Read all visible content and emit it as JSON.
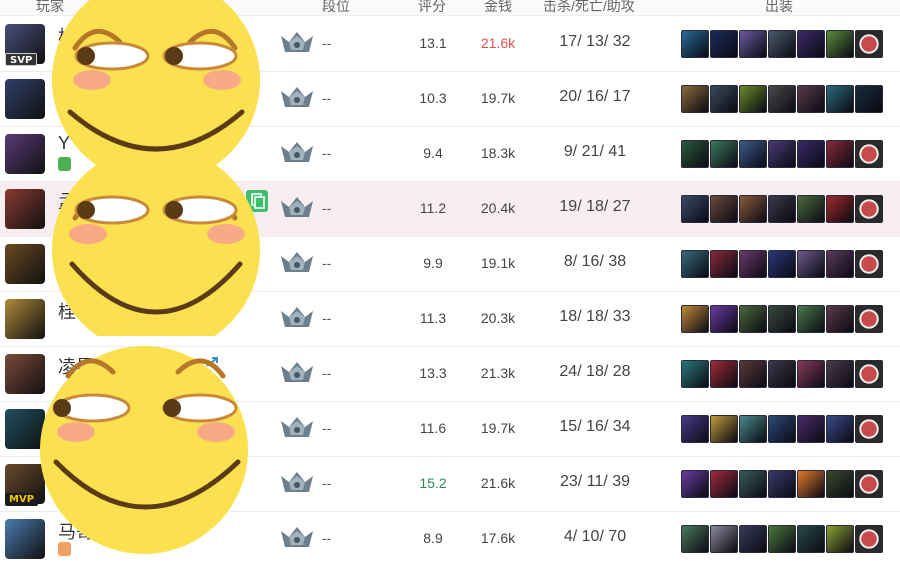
{
  "header": {
    "col_player": "玩家",
    "col_rank": "段位",
    "col_score": "评分",
    "col_gold": "金钱",
    "col_kda": "击杀/死亡/助攻",
    "col_items": "出装"
  },
  "colors": {
    "highlight_row": "#f8eef1",
    "gold_red": "#d9534f",
    "score_green": "#2e8b57",
    "kda_grey": "#888888"
  },
  "players": [
    {
      "name": "横",
      "badge": "SVP",
      "rank": "--",
      "score": "13.1",
      "gold": "21.6k",
      "k": "17",
      "d": "13",
      "a": "32",
      "avatar": "#4a4f7a"
    },
    {
      "name": "",
      "badge": "",
      "rank": "--",
      "score": "10.3",
      "gold": "19.7k",
      "k": "20",
      "d": "16",
      "a": "17",
      "avatar": "#2f3f6b"
    },
    {
      "name": "Y",
      "badge": "",
      "rank": "--",
      "score": "9.4",
      "gold": "18.3k",
      "k": "9",
      "d": "21",
      "a": "41",
      "avatar": "#5a3a7a"
    },
    {
      "name": "孟",
      "badge": "",
      "rank": "--",
      "score": "11.2",
      "gold": "20.4k",
      "k": "19",
      "d": "18",
      "a": "27",
      "avatar": "#8a3a30"
    },
    {
      "name": "",
      "badge": "",
      "rank": "--",
      "score": "9.9",
      "gold": "19.1k",
      "k": "8",
      "d": "16",
      "a": "38",
      "avatar": "#6b4a20"
    },
    {
      "name": "桂",
      "badge": "",
      "rank": "--",
      "score": "11.3",
      "gold": "20.3k",
      "k": "18",
      "d": "18",
      "a": "33",
      "avatar": "#b08a3a"
    },
    {
      "name": "凌晨",
      "badge": "",
      "rank": "--",
      "score": "13.3",
      "gold": "21.3k",
      "k": "24",
      "d": "18",
      "a": "28",
      "avatar": "#7a4a3a"
    },
    {
      "name": "",
      "badge": "",
      "rank": "--",
      "score": "11.6",
      "gold": "19.7k",
      "k": "15",
      "d": "16",
      "a": "34",
      "avatar": "#1f4f5f"
    },
    {
      "name": "",
      "badge": "MVP",
      "rank": "--",
      "score": "15.2",
      "gold": "21.6k",
      "k": "23",
      "d": "11",
      "a": "39",
      "avatar": "#6a4a2a"
    },
    {
      "name": "马哥",
      "badge": "",
      "rank": "--",
      "score": "8.9",
      "gold": "17.6k",
      "k": "4",
      "d": "10",
      "a": "70",
      "avatar": "#4a7ab0"
    }
  ],
  "item_colors": [
    [
      "#2a6a9a",
      "#1a2a5a",
      "#6a5aa0",
      "#4a5a6a",
      "#3a2a6a",
      "#5a8a3a",
      "#ring"
    ],
    [
      "#8a6a3a",
      "#3a4a5a",
      "#6a8a2a",
      "#4a4a4a",
      "#5a3a4a",
      "#2a6a7a",
      "#1a2a3a"
    ],
    [
      "#2a5a3a",
      "#3a7a5a",
      "#3a5a8a",
      "#4a3a7a",
      "#3a2a6a",
      "#8a2a3a",
      "#ring"
    ],
    [
      "#3a4a6a",
      "#6a4a3a",
      "#8a5a3a",
      "#3a3a4a",
      "#4a6a3a",
      "#a02a2a",
      "#ring"
    ],
    [
      "#3a6a7a",
      "#8a2a3a",
      "#6a3a6a",
      "#2a3a7a",
      "#6a5a8a",
      "#5a3a5a",
      "#ring"
    ],
    [
      "#c08a3a",
      "#6a3aa0",
      "#4a6a3a",
      "#3a4a3a",
      "#4a7a4a",
      "#5a3a4a",
      "#ring"
    ],
    [
      "#2a7a7a",
      "#a02a3a",
      "#5a3a3a",
      "#3a3a4a",
      "#8a3a5a",
      "#4a3a4a",
      "#ring"
    ],
    [
      "#4a3a8a",
      "#c09a3a",
      "#4a8a8a",
      "#2a4a7a",
      "#4a2a6a",
      "#3a4a8a",
      "#ring"
    ],
    [
      "#6a3aa0",
      "#a02a3a",
      "#3a5a5a",
      "#3a3a6a",
      "#e07a2a",
      "#3a4a2a",
      "#ring"
    ],
    [
      "#4a7a5a",
      "#8a8a9a",
      "#3a3a5a",
      "#4a7a3a",
      "#2a4a4a",
      "#8aa030",
      "#ring"
    ]
  ]
}
